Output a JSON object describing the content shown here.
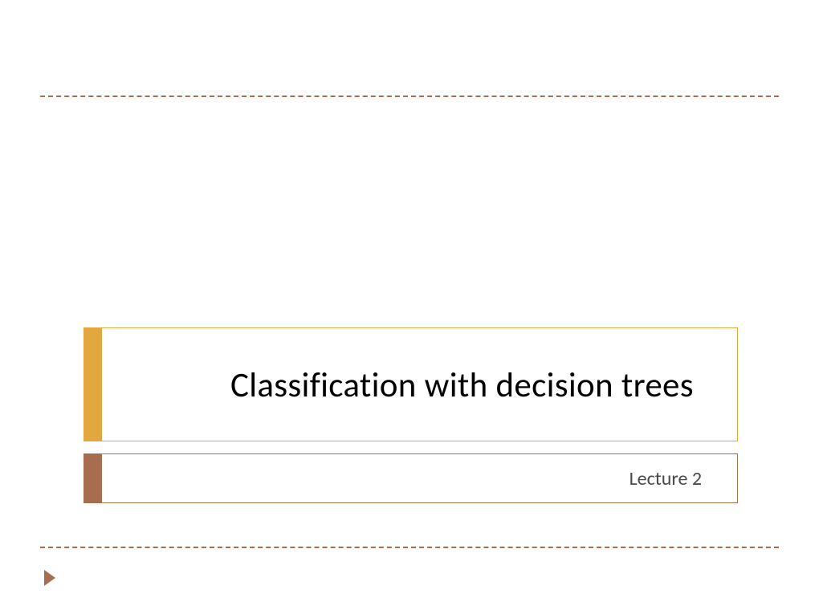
{
  "slide": {
    "title": "Classification with decision trees",
    "subtitle": "Lecture 2"
  },
  "colors": {
    "accent_gold": "#e2a73e",
    "accent_brown": "#a76d4f"
  }
}
